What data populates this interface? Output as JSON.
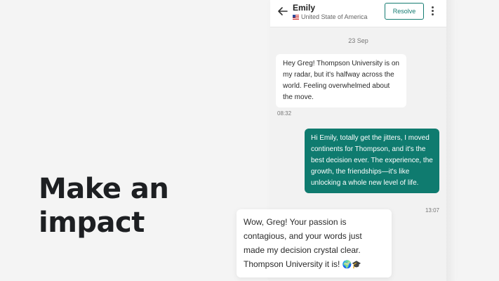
{
  "hero": {
    "line1": "Make an",
    "line2": "impact"
  },
  "header": {
    "contact_name": "Emily",
    "contact_country": "United State of America",
    "resolve_label": "Resolve",
    "back_icon": "arrow-left-icon",
    "menu_icon": "kebab-menu-icon"
  },
  "chat": {
    "date_divider": "23 Sep",
    "messages": [
      {
        "direction": "incoming",
        "text": "Hey Greg! Thompson University is on my radar, but it's halfway across the world. Feeling overwhelmed about the move.",
        "time": "08:32"
      },
      {
        "direction": "outgoing",
        "text": "Hi Emily, totally get the jitters, I moved continents for Thompson, and it's the best decision ever. The experience, the growth, the friendships—it's like unlocking a whole new level of life.",
        "time": "13:07"
      },
      {
        "direction": "incoming",
        "text": "Wow, Greg! Your passion is contagious, and your words just made my decision crystal clear. Thompson University it is!",
        "emoji": "🌍🎓"
      }
    ]
  },
  "colors": {
    "accent": "#0f7b6f",
    "background": "#f4f4f4",
    "bubble_incoming": "#ffffff",
    "hero_text": "#1d1f22"
  }
}
